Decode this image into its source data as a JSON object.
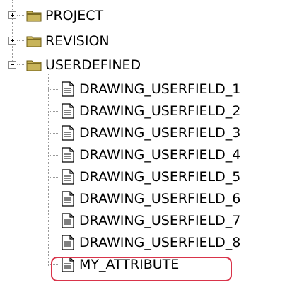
{
  "tree": {
    "nodes": [
      {
        "label": "PROJECT",
        "kind": "folder",
        "state": "collapsed"
      },
      {
        "label": "REVISION",
        "kind": "folder",
        "state": "collapsed"
      },
      {
        "label": "USERDEFINED",
        "kind": "folder",
        "state": "expanded"
      }
    ],
    "children": [
      {
        "label": "DRAWING_USERFIELD_1"
      },
      {
        "label": "DRAWING_USERFIELD_2"
      },
      {
        "label": "DRAWING_USERFIELD_3"
      },
      {
        "label": "DRAWING_USERFIELD_4"
      },
      {
        "label": "DRAWING_USERFIELD_5"
      },
      {
        "label": "DRAWING_USERFIELD_6"
      },
      {
        "label": "DRAWING_USERFIELD_7"
      },
      {
        "label": "DRAWING_USERFIELD_8"
      },
      {
        "label": "MY_ATTRIBUTE",
        "highlighted": true
      }
    ]
  },
  "colors": {
    "folder_body": "#c8b45a",
    "folder_dark": "#6b5a12",
    "highlight_border": "#d9344a"
  },
  "icons": {
    "expand": "plus-box-icon",
    "collapse": "minus-box-icon",
    "folder": "folder-icon",
    "document": "document-icon"
  }
}
